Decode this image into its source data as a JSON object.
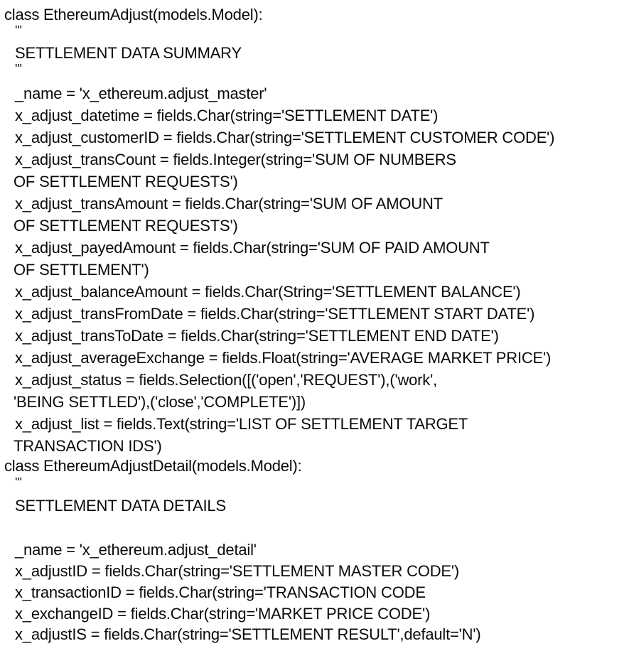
{
  "code_lines": [
    "class EthereumAdjust(models.Model):",
    "'''",
    "SETTLEMENT DATA SUMMARY",
    "'''",
    "_name = 'x_ethereum.adjust_master'",
    "x_adjust_datetime = fields.Char(string='SETTLEMENT DATE')",
    "x_adjust_customerID = fields.Char(string='SETTLEMENT CUSTOMER CODE')",
    "x_adjust_transCount = fields.Integer(string='SUM OF NUMBERS",
    "OF SETTLEMENT REQUESTS')",
    "x_adjust_transAmount = fields.Char(string='SUM OF AMOUNT",
    "OF SETTLEMENT REQUESTS')",
    "x_adjust_payedAmount = fields.Char(string='SUM OF PAID AMOUNT",
    "OF SETTLEMENT')",
    "x_adjust_balanceAmount = fields.Char(String='SETTLEMENT BALANCE')",
    "x_adjust_transFromDate = fields.Char(string='SETTLEMENT START DATE')",
    "x_adjust_transToDate = fields.Char(string='SETTLEMENT END DATE')",
    "x_adjust_averageExchange = fields.Float(string='AVERAGE MARKET PRICE')",
    "x_adjust_status = fields.Selection([('open','REQUEST'),('work',",
    "'BEING SETTLED'),('close','COMPLETE')])",
    "x_adjust_list = fields.Text(string='LIST OF SETTLEMENT TARGET",
    "TRANSACTION IDS')",
    "class EthereumAdjustDetail(models.Model):",
    "'''",
    "SETTLEMENT DATA DETAILS",
    "_name = 'x_ethereum.adjust_detail'",
    "x_adjustID = fields.Char(string='SETTLEMENT MASTER CODE')",
    "x_transactionID = fields.Char(string='TRANSACTION CODE",
    "x_exchangeID = fields.Char(string='MARKET PRICE CODE')",
    "x_adjustIS = fields.Char(string='SETTLEMENT RESULT',default='N')"
  ]
}
